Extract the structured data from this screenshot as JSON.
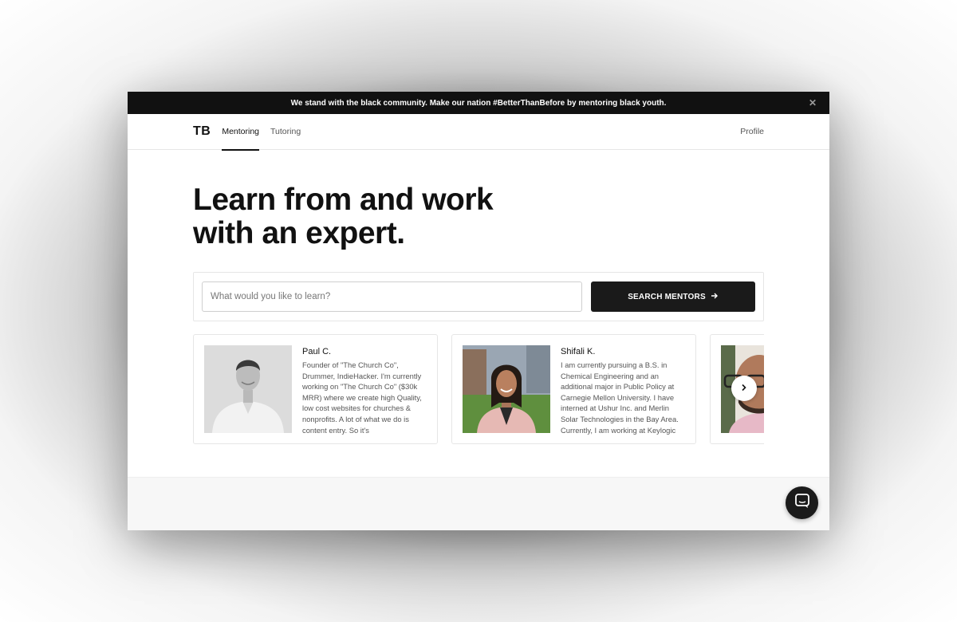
{
  "banner": {
    "text": "We stand with the black community. Make our nation #BetterThanBefore by mentoring black youth.",
    "close_icon": "close-icon"
  },
  "nav": {
    "logo": "TB",
    "tabs": [
      {
        "label": "Mentoring",
        "active": true
      },
      {
        "label": "Tutoring",
        "active": false
      }
    ],
    "profile": "Profile"
  },
  "hero": {
    "title_line1": "Learn from and work",
    "title_line2": "with an expert."
  },
  "search": {
    "placeholder": "What would you like to learn?",
    "value": "",
    "button_label": "SEARCH MENTORS",
    "button_icon": "arrow-right-icon"
  },
  "mentors": [
    {
      "name": "Paul C.",
      "bio": "Founder of \"The Church Co\", Drummer, IndieHacker. I'm currently working on \"The Church Co\" ($30k MRR) where we create high Quality, low cost websites for churches & nonprofits. A lot of what we do is content entry. So it's"
    },
    {
      "name": "Shifali K.",
      "bio": "I am currently pursuing a B.S. in Chemical Engineering and an additional major in Public Policy at Carnegie Mellon University. I have interned at Ushur Inc. and Merlin Solar Technologies in the Bay Area. Currently, I am working at Keylogic"
    },
    {
      "name": "",
      "bio": ""
    }
  ],
  "carousel": {
    "next_icon": "chevron-right-icon"
  },
  "chat": {
    "icon": "chat-icon"
  },
  "colors": {
    "banner_bg": "#111111",
    "button_bg": "#1a1a1a",
    "text_primary": "#111111",
    "text_secondary": "#555555"
  }
}
